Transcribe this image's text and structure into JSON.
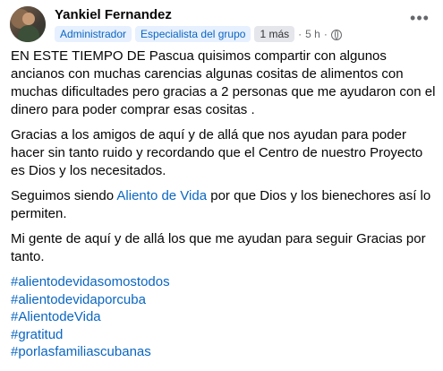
{
  "author": {
    "name": "Yankiel Fernandez"
  },
  "badges": {
    "admin": "Administrador",
    "specialist": "Especialista del grupo",
    "tenure": "1 más"
  },
  "meta": {
    "separator": "·",
    "time": "5 h",
    "separator2": "·"
  },
  "icons": {
    "more": "more-options-icon",
    "globe": "globe-icon"
  },
  "post": {
    "p1": "EN ESTE TIEMPO DE Pascua quisimos compartir con algunos ancianos con muchas carencias algunas cositas de alimentos  con muchas dificultades pero gracias a 2 personas que me ayudaron con el dinero para poder comprar esas cositas .",
    "p2": "Gracias a los amigos de aquí y de allá que nos ayudan para poder hacer sin tanto ruido y recordando que el Centro de nuestro Proyecto es Dios y los necesitados.",
    "p3_before": "Seguimos siendo ",
    "p3_link": "Aliento de Vida",
    "p3_after": " por que Dios y los bienechores así lo permiten.",
    "p4": "Mi gente de aquí y de allá los que me ayudan para seguir Gracias por tanto."
  },
  "hashtags": [
    "#alientodevidasomostodos",
    "#alientodevidaporcuba",
    "#AlientodeVida",
    "#gratitud",
    "#porlasfamiliascubanas"
  ],
  "colors": {
    "link": "#0a66c2",
    "meta": "#65676b"
  }
}
